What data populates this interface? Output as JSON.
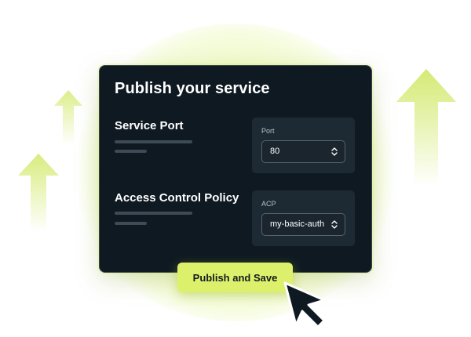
{
  "card": {
    "title": "Publish your service"
  },
  "service_port": {
    "label": "Service Port",
    "field_label": "Port",
    "value": "80",
    "icon": "chevron-up-down-icon"
  },
  "access_control": {
    "label": "Access Control Policy",
    "field_label": "ACP",
    "value": "my-basic-auth",
    "icon": "chevron-up-down-icon"
  },
  "actions": {
    "publish_label": "Publish and Save"
  },
  "decorations": {
    "cursor_icon": "mouse-pointer-icon",
    "arrow_icon": "arrow-up-icon"
  },
  "colors": {
    "accent": "#ddf06b",
    "card_background": "#0f1922",
    "panel_background": "#1e2a33"
  }
}
